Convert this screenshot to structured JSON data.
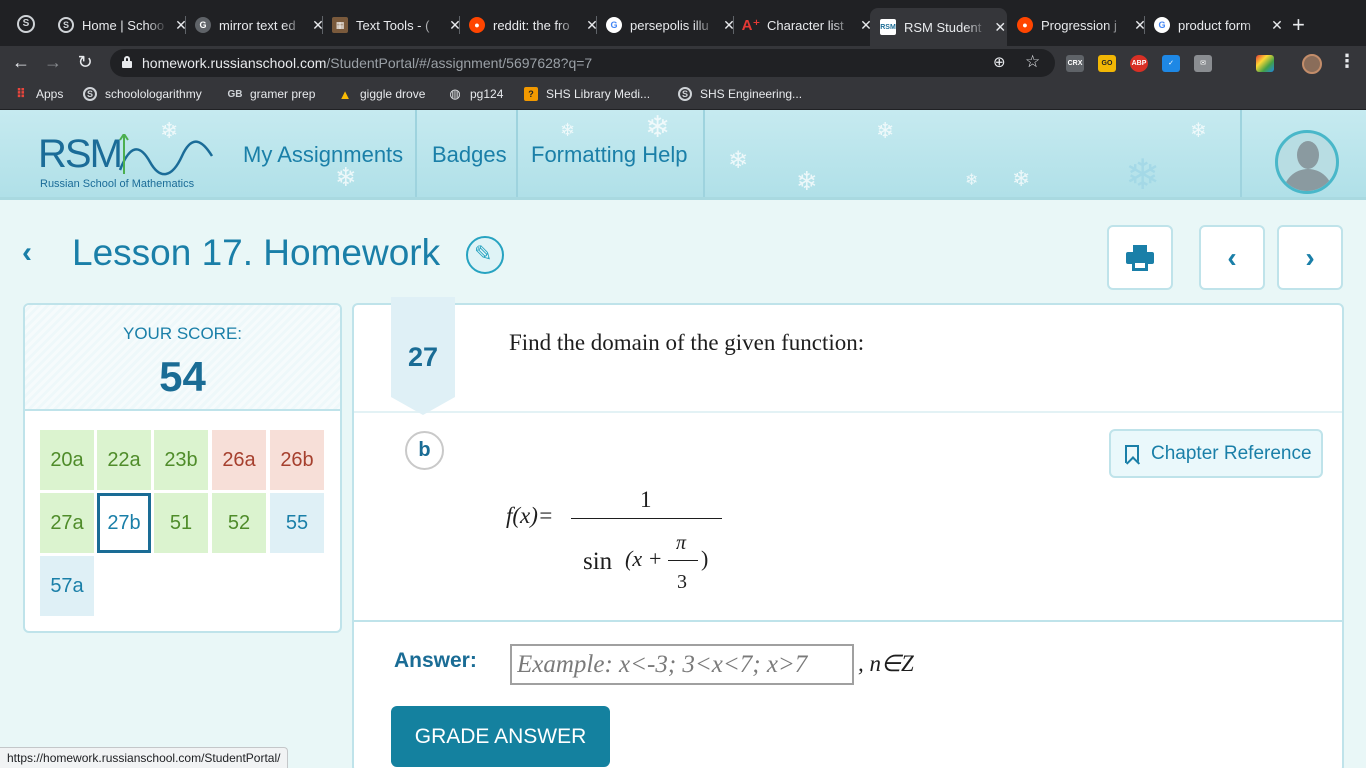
{
  "browser": {
    "tabs": [
      {
        "label": "Home | Schoo",
        "icon": "s-circle-icon",
        "active": false
      },
      {
        "label": "mirror text ed",
        "icon": "google-icon",
        "active": false
      },
      {
        "label": "Text Tools - (",
        "icon": "text-tools-icon",
        "active": false
      },
      {
        "label": "reddit: the fro",
        "icon": "reddit-icon",
        "active": false
      },
      {
        "label": "persepolis illu",
        "icon": "google-icon",
        "active": false
      },
      {
        "label": "Character list",
        "icon": "a-plus-icon",
        "active": false
      },
      {
        "label": "RSM Student",
        "icon": "rsm-icon",
        "active": true
      },
      {
        "label": "Progression j",
        "icon": "reddit-icon",
        "active": false
      },
      {
        "label": "product form",
        "icon": "google-icon",
        "active": false
      }
    ],
    "url_host": "homework.russianschool.com",
    "url_path": "/StudentPortal/#/assignment/5697628?q=7",
    "extensions": [
      "CRX",
      "GO",
      "ABP"
    ],
    "bookmarks": [
      {
        "label": "Apps",
        "icon": "apps-grid-icon"
      },
      {
        "label": "schoolologarithmy",
        "icon": "s-circle-icon"
      },
      {
        "label": "gramer prep",
        "icon": "gb-icon"
      },
      {
        "label": "giggle drove",
        "icon": "drive-icon"
      },
      {
        "label": "pg124",
        "icon": "globe-icon"
      },
      {
        "label": "SHS Library Medi...",
        "icon": "library-icon"
      },
      {
        "label": "SHS Engineering...",
        "icon": "s-circle-icon"
      }
    ],
    "status_url": "https://homework.russianschool.com/StudentPortal/"
  },
  "header": {
    "logo_text": "RSM",
    "logo_subtitle": "Russian School of Mathematics",
    "nav": [
      "My Assignments",
      "Badges",
      "Formatting Help"
    ]
  },
  "lesson": {
    "title": "Lesson 17. Homework"
  },
  "score": {
    "label": "YOUR SCORE:",
    "value": "54",
    "problems": [
      {
        "label": "20a",
        "status": "green"
      },
      {
        "label": "22a",
        "status": "green"
      },
      {
        "label": "23b",
        "status": "green"
      },
      {
        "label": "26a",
        "status": "pink"
      },
      {
        "label": "26b",
        "status": "pink"
      },
      {
        "label": "27a",
        "status": "green"
      },
      {
        "label": "27b",
        "status": "current"
      },
      {
        "label": "51",
        "status": "green"
      },
      {
        "label": "52",
        "status": "green"
      },
      {
        "label": "55",
        "status": "blue"
      },
      {
        "label": "57a",
        "status": "blue"
      }
    ]
  },
  "problem": {
    "number": "27",
    "prompt": "Find the domain of the given function:",
    "part": "b",
    "chapter_ref_label": "Chapter Reference",
    "formula": {
      "lhs": "f(x)=",
      "numerator": "1",
      "sin": "sin",
      "paren_open": "(x +",
      "pi": "π",
      "three": "3",
      "paren_close": ")"
    },
    "answer_label": "Answer:",
    "answer_placeholder": "Example: x<-3; 3<x<7; x>7",
    "answer_suffix": ", n∈Z",
    "grade_button": "GRADE ANSWER"
  },
  "colors": {
    "accent": "#1a7fa8",
    "button": "#14819f",
    "correct_bg": "#dbf3cf",
    "wrong_bg": "#f7dfd8",
    "pending_bg": "#dff0f6"
  }
}
